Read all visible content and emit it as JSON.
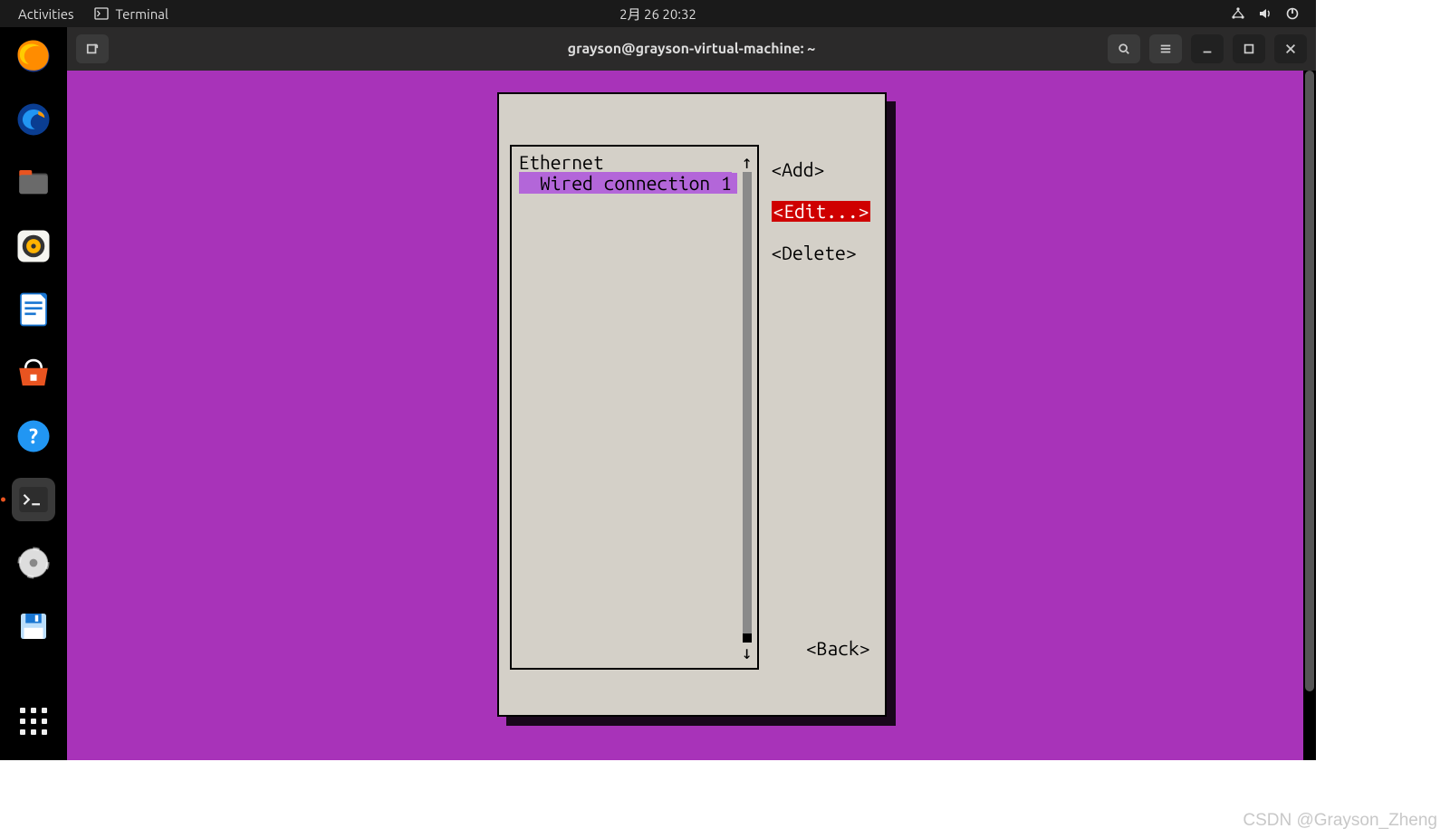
{
  "topbar": {
    "activities": "Activities",
    "app_label": "Terminal",
    "clock": "2月 26  20:32"
  },
  "window": {
    "title": "grayson@grayson-virtual-machine: ~"
  },
  "nmtui": {
    "category": "Ethernet",
    "selected_item": "  Wired connection 1",
    "buttons": {
      "add": "<Add>",
      "edit": "<Edit...>",
      "delete": "<Delete>",
      "back": "<Back>"
    }
  },
  "dock": {
    "items": [
      "firefox",
      "thunderbird",
      "files",
      "rhythmbox",
      "libreoffice-writer",
      "ubuntu-software",
      "help",
      "terminal",
      "disk",
      "save"
    ]
  },
  "watermark": "CSDN @Grayson_Zheng"
}
